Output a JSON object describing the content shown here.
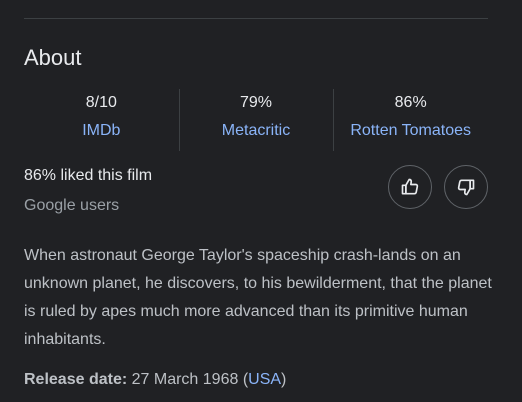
{
  "about": {
    "title": "About",
    "ratings": [
      {
        "score": "8/10",
        "source": "IMDb"
      },
      {
        "score": "79%",
        "source": "Metacritic"
      },
      {
        "score": "86%",
        "source": "Rotten Tomatoes"
      }
    ],
    "liked": {
      "text": "86% liked this film",
      "sub": "Google users",
      "thumbs_up_icon": "thumbs-up-icon",
      "thumbs_down_icon": "thumbs-down-icon"
    },
    "description": "When astronaut George Taylor's spaceship crash-lands on an unknown planet, he discovers, to his bewilderment, that the planet is ruled by apes much more advanced than its primitive human inhabitants.",
    "release": {
      "label": "Release date:",
      "date": "27 March 1968",
      "open_paren": "(",
      "country": "USA",
      "close_paren": ")"
    },
    "colors": {
      "background": "#202124",
      "text": "#e8eaed",
      "secondary_text": "#9aa0a6",
      "link": "#8ab4f8",
      "divider": "#3c4043"
    }
  }
}
